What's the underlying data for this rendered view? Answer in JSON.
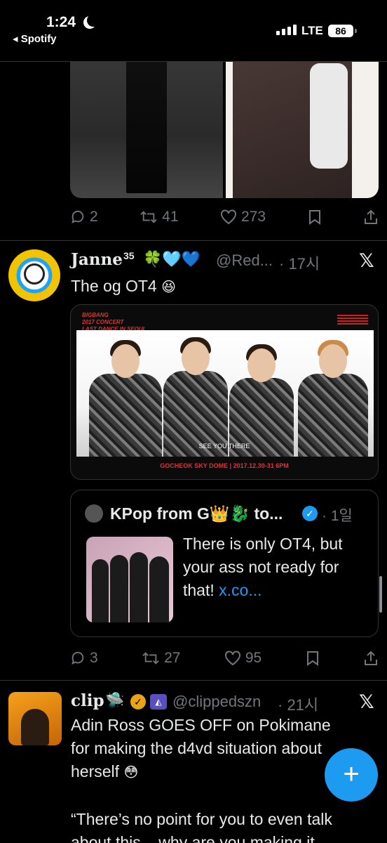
{
  "status_bar": {
    "time": "1:24",
    "back_app": "◂ Spotify",
    "network": "LTE",
    "battery": "86"
  },
  "tweet_top": {
    "replies": "2",
    "retweets": "41",
    "likes": "273"
  },
  "tweet_janne": {
    "name": "Janne",
    "superscript": "35",
    "emojis": "🍀🩵💙",
    "handle": "@Red...",
    "time": "· 17시",
    "text": "The og OT4",
    "text_emoji": "😆",
    "video": {
      "header_lines": [
        "BIGBANG",
        "2017 CONCERT",
        "LAST DANCE IN SEOUL"
      ],
      "subtitle": "SEE YOU THERE",
      "footer": "GOCHEOK SKY DOME  |  2017.12.30-31 6PM"
    },
    "quote": {
      "name": "KPop from G👑🐉 to...",
      "time": "· 1일",
      "text": "There is only OT4, but your ass not ready for that!",
      "link": "x.co..."
    },
    "replies": "3",
    "retweets": "27",
    "likes": "95"
  },
  "tweet_clip": {
    "name": "clip",
    "emoji": "🛸",
    "handle": "@clippedszn",
    "time": "· 21시",
    "text_line1": "Adin Ross GOES OFF on Pokimane",
    "text_line2": "for making the d4vd situation about",
    "text_line3": "herself",
    "text_emoji": "😳",
    "quote_line1": "“There’s no point for you to even talk",
    "quote_line2": "about this... why are you making it"
  },
  "icons": {
    "reply": "💬",
    "retweet": "⟲",
    "like": "♡",
    "bookmark": "bookmark",
    "share": "share",
    "x_logo": "𝕏",
    "fab": "+"
  },
  "colors": {
    "accent": "#1d9bf0",
    "muted": "#71767b",
    "background": "#000000"
  }
}
